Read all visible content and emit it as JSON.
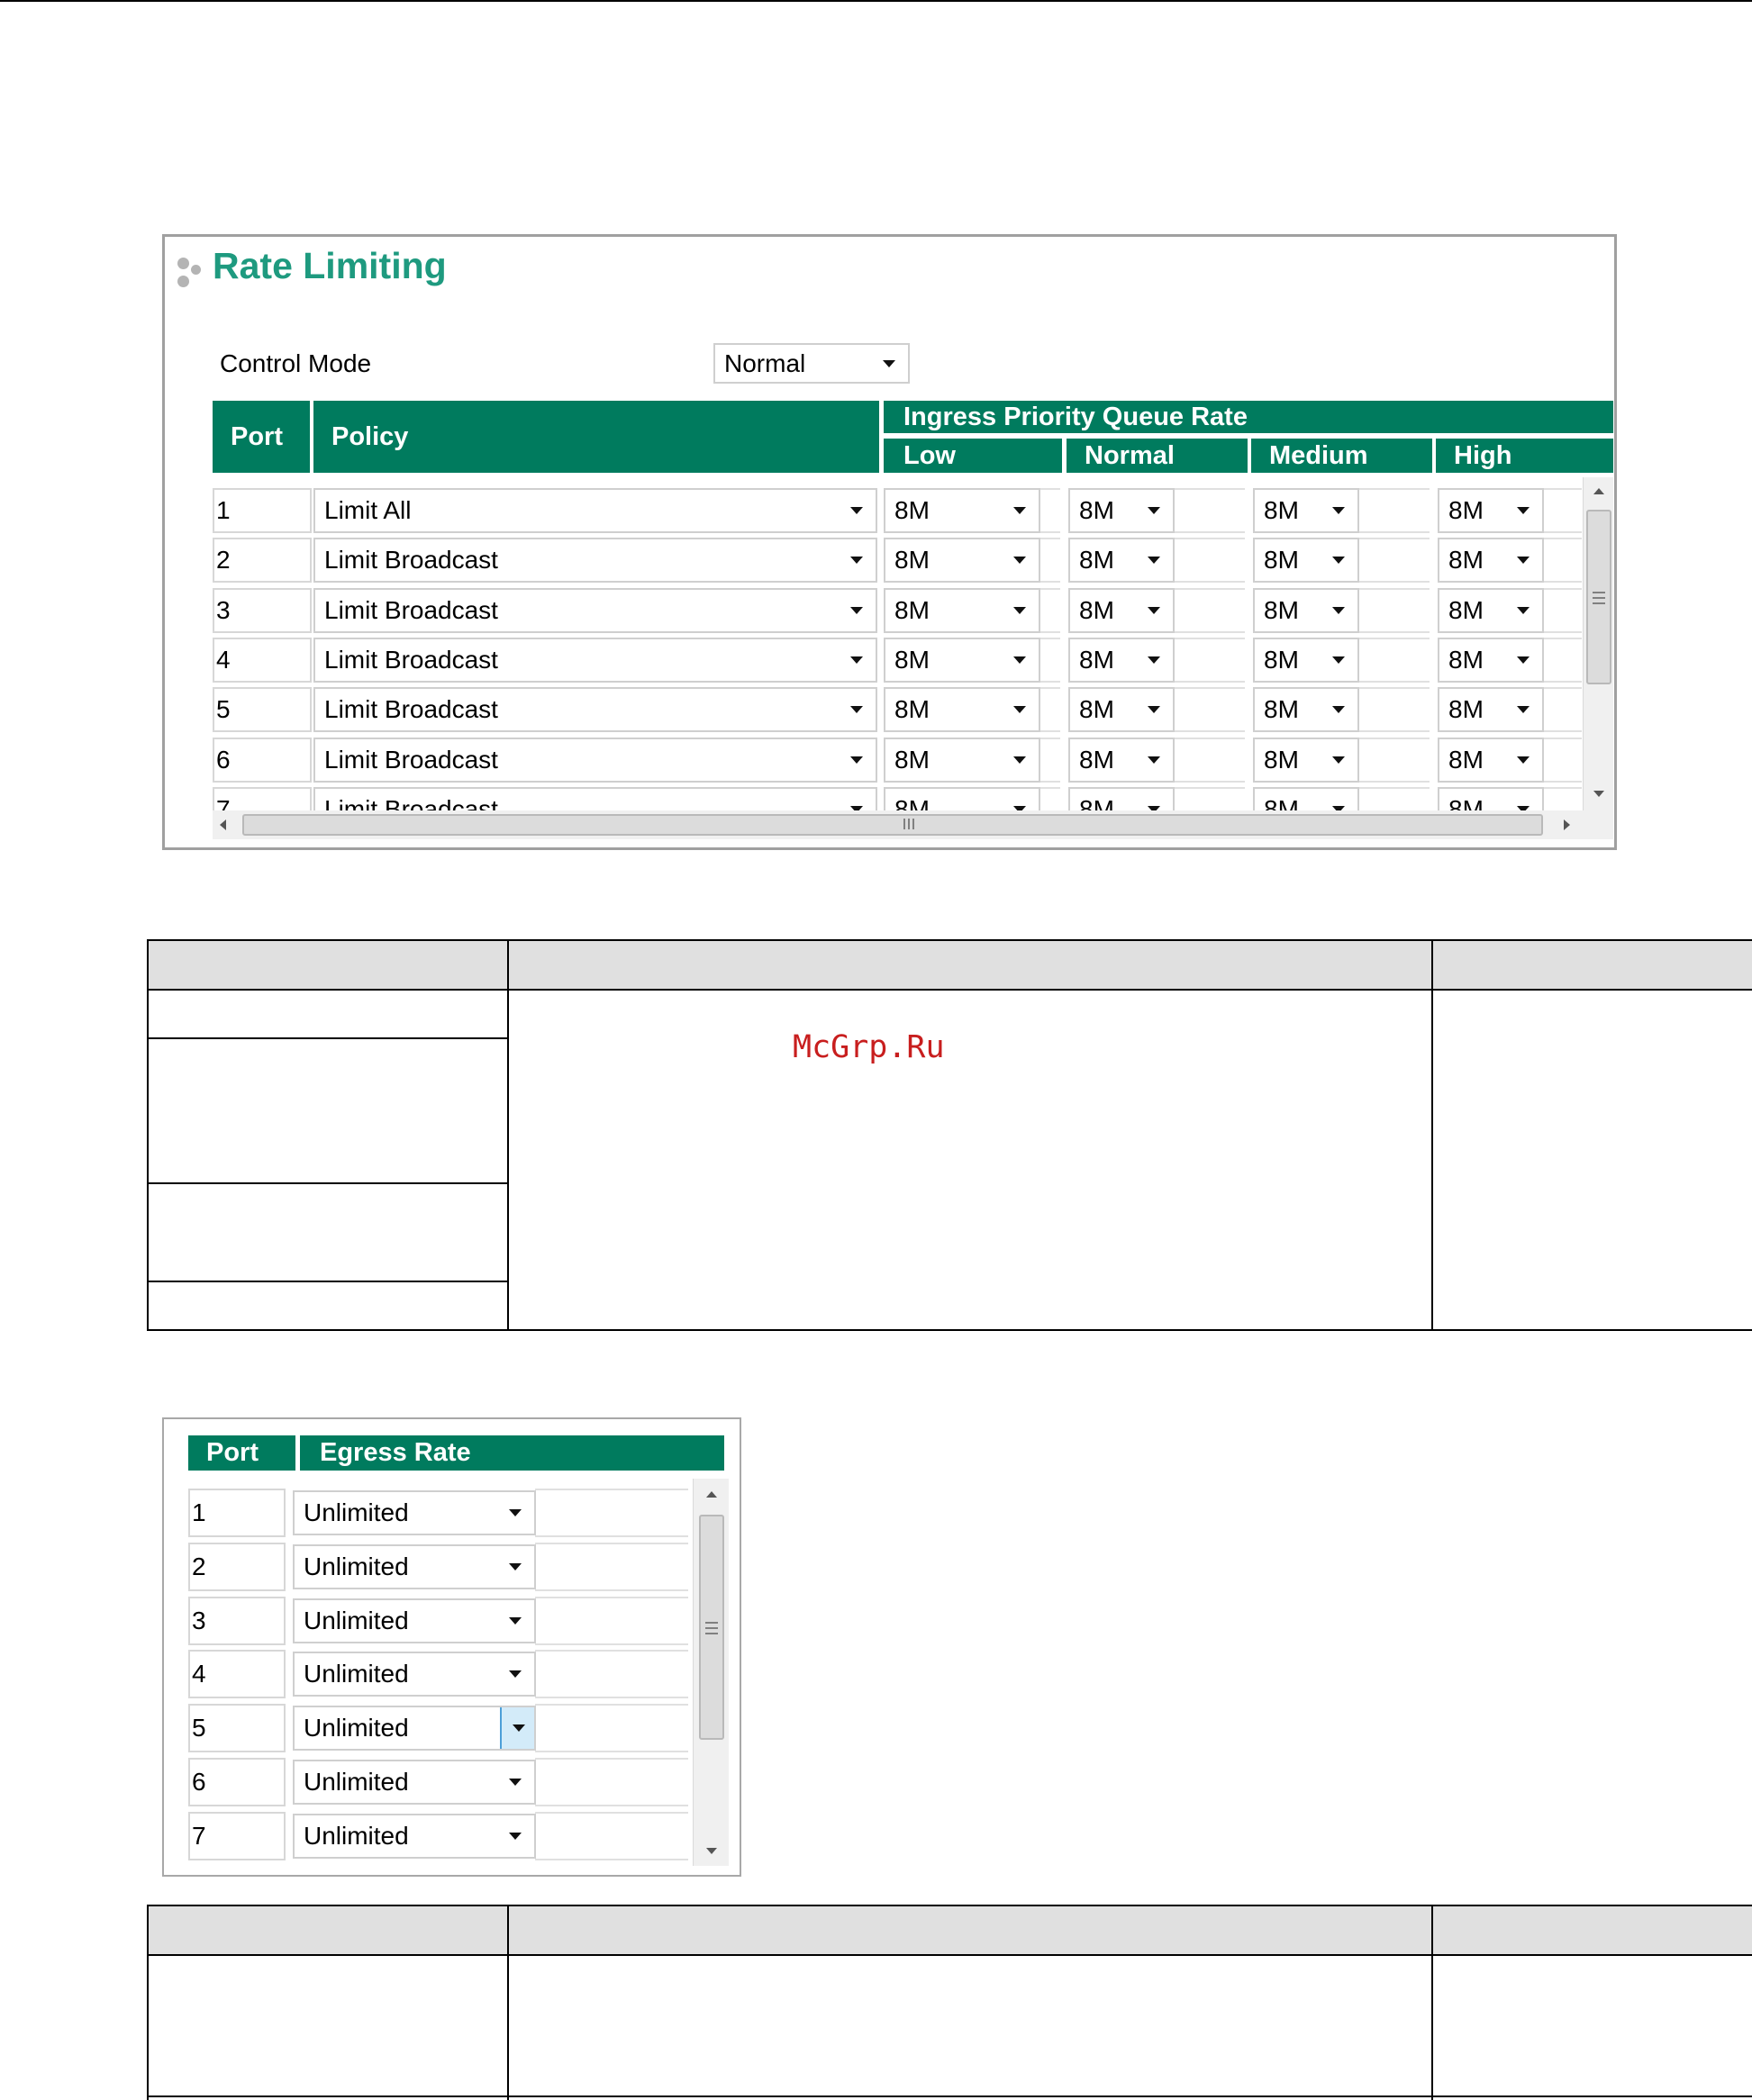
{
  "panel_title": "Rate Limiting",
  "control_mode": {
    "label": "Control Mode",
    "value": "Normal"
  },
  "ingress_table": {
    "col_port": "Port",
    "col_policy": "Policy",
    "group_header": "Ingress Priority Queue Rate",
    "priorities": [
      "Low",
      "Normal",
      "Medium",
      "High"
    ],
    "rows": [
      {
        "port": "1",
        "policy": "Limit All",
        "low": "8M",
        "normal": "8M",
        "medium": "8M",
        "high": "8M"
      },
      {
        "port": "2",
        "policy": "Limit Broadcast",
        "low": "8M",
        "normal": "8M",
        "medium": "8M",
        "high": "8M"
      },
      {
        "port": "3",
        "policy": "Limit Broadcast",
        "low": "8M",
        "normal": "8M",
        "medium": "8M",
        "high": "8M"
      },
      {
        "port": "4",
        "policy": "Limit Broadcast",
        "low": "8M",
        "normal": "8M",
        "medium": "8M",
        "high": "8M"
      },
      {
        "port": "5",
        "policy": "Limit Broadcast",
        "low": "8M",
        "normal": "8M",
        "medium": "8M",
        "high": "8M"
      },
      {
        "port": "6",
        "policy": "Limit Broadcast",
        "low": "8M",
        "normal": "8M",
        "medium": "8M",
        "high": "8M"
      },
      {
        "port": "7",
        "policy": "Limit Broadcast",
        "low": "8M",
        "normal": "8M",
        "medium": "8M",
        "high": "8M"
      }
    ]
  },
  "watermark": "McGrp.Ru",
  "egress_table": {
    "col_port": "Port",
    "col_rate": "Egress Rate",
    "rows": [
      {
        "port": "1",
        "rate": "Unlimited"
      },
      {
        "port": "2",
        "rate": "Unlimited"
      },
      {
        "port": "3",
        "rate": "Unlimited"
      },
      {
        "port": "4",
        "rate": "Unlimited"
      },
      {
        "port": "5",
        "rate": "Unlimited"
      },
      {
        "port": "6",
        "rate": "Unlimited"
      },
      {
        "port": "7",
        "rate": "Unlimited"
      }
    ]
  },
  "colors": {
    "header_green": "#007b5e",
    "title_green": "#1e9a7f",
    "table_header_gray": "#e0e0e0",
    "watermark_red": "#c81e1e"
  }
}
